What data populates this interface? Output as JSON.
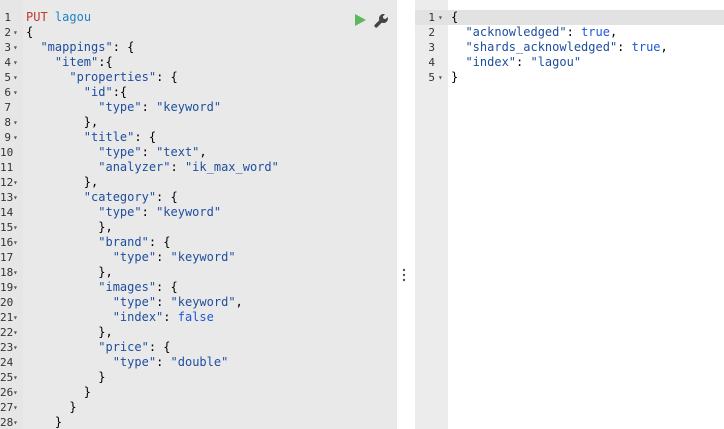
{
  "request": {
    "method": "PUT",
    "path": "lagou",
    "lines": [
      [
        "{"
      ],
      [
        "  ",
        {
          "k": "\"mappings\""
        },
        ": {"
      ],
      [
        "    ",
        {
          "k": "\"item\""
        },
        ":{"
      ],
      [
        "      ",
        {
          "k": "\"properties\""
        },
        ": {"
      ],
      [
        "        ",
        {
          "k": "\"id\""
        },
        ":{"
      ],
      [
        "          ",
        {
          "k": "\"type\""
        },
        ": ",
        {
          "s": "\"keyword\""
        }
      ],
      [
        "        },"
      ],
      [
        "        ",
        {
          "k": "\"title\""
        },
        ": {"
      ],
      [
        "          ",
        {
          "k": "\"type\""
        },
        ": ",
        {
          "s": "\"text\""
        },
        ","
      ],
      [
        "          ",
        {
          "k": "\"analyzer\""
        },
        ": ",
        {
          "s": "\"ik_max_word\""
        }
      ],
      [
        "        },"
      ],
      [
        "        ",
        {
          "k": "\"category\""
        },
        ": {"
      ],
      [
        "          ",
        {
          "k": "\"type\""
        },
        ": ",
        {
          "s": "\"keyword\""
        }
      ],
      [
        "          },"
      ],
      [
        "          ",
        {
          "k": "\"brand\""
        },
        ": {"
      ],
      [
        "            ",
        {
          "k": "\"type\""
        },
        ": ",
        {
          "s": "\"keyword\""
        }
      ],
      [
        "          },"
      ],
      [
        "          ",
        {
          "k": "\"images\""
        },
        ": {"
      ],
      [
        "            ",
        {
          "k": "\"type\""
        },
        ": ",
        {
          "s": "\"keyword\""
        },
        ","
      ],
      [
        "            ",
        {
          "k": "\"index\""
        },
        ": ",
        {
          "b": "false"
        }
      ],
      [
        "          },"
      ],
      [
        "          ",
        {
          "k": "\"price\""
        },
        ": {"
      ],
      [
        "            ",
        {
          "k": "\"type\""
        },
        ": ",
        {
          "s": "\"double\""
        }
      ],
      [
        "          }"
      ],
      [
        "        }"
      ],
      [
        "      }"
      ],
      [
        "    }"
      ]
    ],
    "gutter": [
      "1",
      "2",
      "3",
      "4",
      "5",
      "6",
      "7",
      "8",
      "9",
      "10",
      "11",
      "12",
      "13",
      "14",
      "15",
      "16",
      "17",
      "18",
      "19",
      "20",
      "21",
      "22",
      "23",
      "24",
      "25",
      "26",
      "27",
      "28"
    ],
    "fold_lines": [
      2,
      3,
      4,
      5,
      6,
      8,
      9,
      12,
      13,
      15,
      16,
      18,
      19,
      21,
      22,
      23,
      25,
      26,
      27,
      28
    ]
  },
  "response": {
    "lines": [
      [
        "{"
      ],
      [
        "  ",
        {
          "k": "\"acknowledged\""
        },
        ": ",
        {
          "b": "true"
        },
        ","
      ],
      [
        "  ",
        {
          "k": "\"shards_acknowledged\""
        },
        ": ",
        {
          "b": "true"
        },
        ","
      ],
      [
        "  ",
        {
          "k": "\"index\""
        },
        ": ",
        {
          "s": "\"lagou\""
        }
      ],
      [
        "}"
      ]
    ],
    "gutter": [
      "1",
      "2",
      "3",
      "4",
      "5"
    ],
    "fold_lines": [
      1,
      5
    ]
  },
  "icons": {
    "run": "play-icon",
    "settings": "wrench-icon",
    "resize": "drag-handle-icon"
  },
  "colors": {
    "key": "#1f4e9e",
    "boolean": "#1f57d6",
    "method": "#c0392b",
    "url": "#1d82c6",
    "run": "#5cb85c"
  }
}
